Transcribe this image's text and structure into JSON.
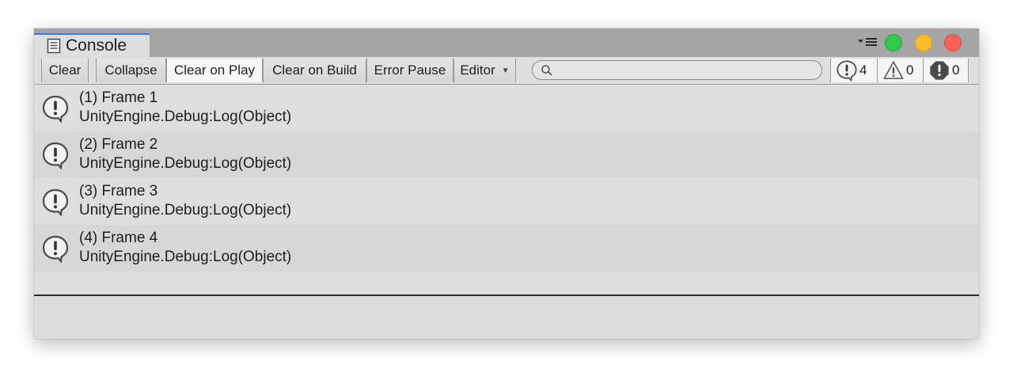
{
  "window": {
    "tab_title": "Console",
    "tab_icon": "console-document-icon",
    "menu_icon": "options-menu-icon",
    "traffic_lights": {
      "green": "#2ecb4a",
      "yellow": "#fdbc2e",
      "red": "#ff5f57"
    }
  },
  "toolbar": {
    "clear": "Clear",
    "collapse": "Collapse",
    "clear_on_play": "Clear on Play",
    "clear_on_play_active": true,
    "clear_on_build": "Clear on Build",
    "error_pause": "Error Pause",
    "editor": "Editor",
    "search": {
      "value": "",
      "placeholder": ""
    }
  },
  "counters": {
    "info": "4",
    "warning": "0",
    "error": "0"
  },
  "logs": [
    {
      "message": "(1) Frame 1",
      "stack": "UnityEngine.Debug:Log(Object)",
      "icon": "info-speech-icon"
    },
    {
      "message": "(2) Frame 2",
      "stack": "UnityEngine.Debug:Log(Object)",
      "icon": "info-speech-icon"
    },
    {
      "message": "(3) Frame 3",
      "stack": "UnityEngine.Debug:Log(Object)",
      "icon": "info-speech-icon"
    },
    {
      "message": "(4) Frame 4",
      "stack": "UnityEngine.Debug:Log(Object)",
      "icon": "info-speech-icon"
    }
  ]
}
